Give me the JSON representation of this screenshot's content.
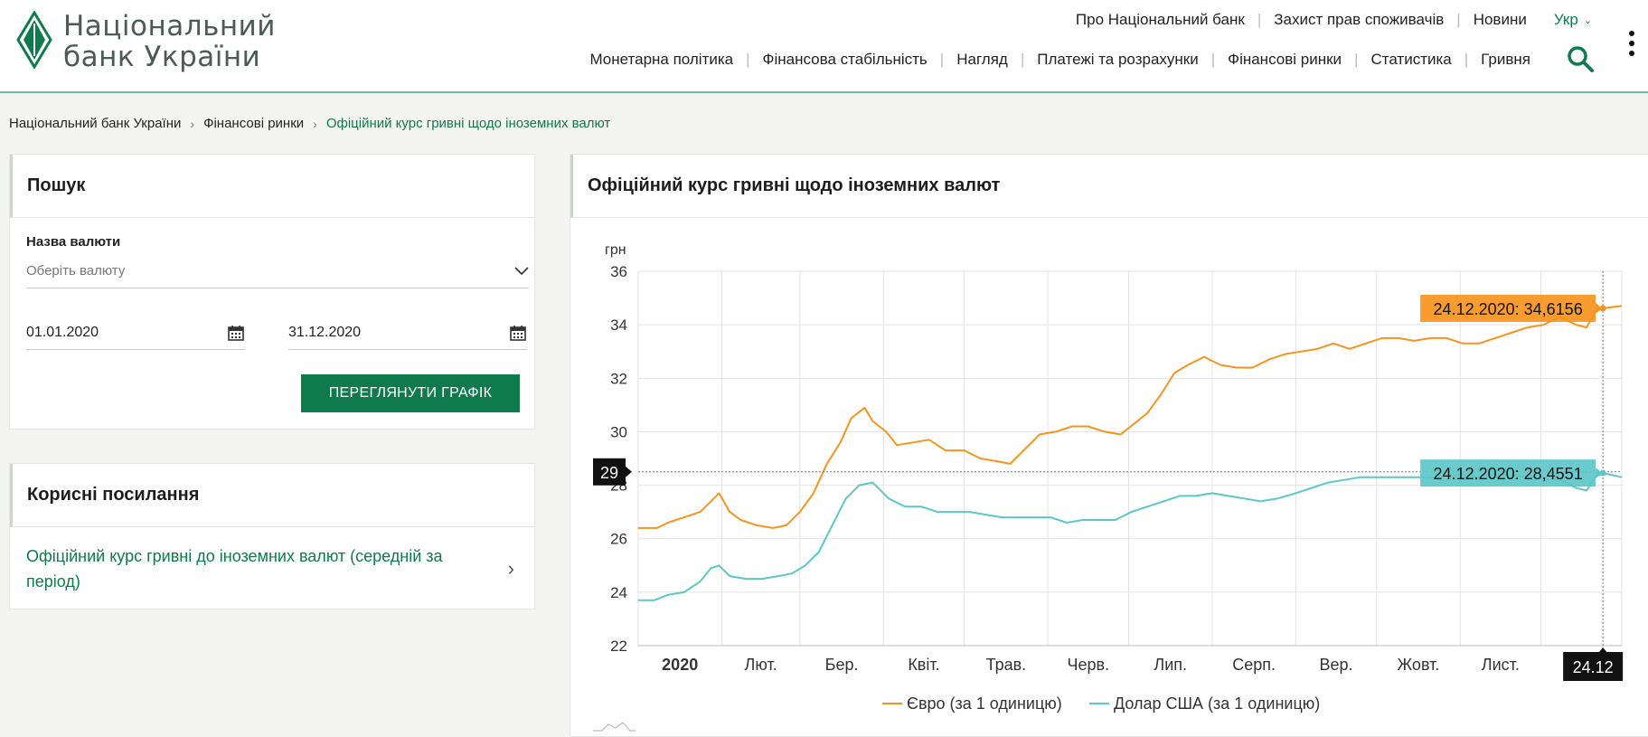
{
  "header": {
    "logo_line1": "Національний",
    "logo_line2": "банк України",
    "top_links": [
      "Про Національний банк",
      "Захист прав споживачів",
      "Новини"
    ],
    "language": "Укр",
    "main_nav": [
      "Монетарна політика",
      "Фінансова стабільність",
      "Нагляд",
      "Платежі та розрахунки",
      "Фінансові ринки",
      "Статистика",
      "Гривня"
    ],
    "brand_color": "#0f7b4c"
  },
  "breadcrumb": {
    "items": [
      "Національний банк України",
      "Фінансові ринки"
    ],
    "current": "Офіційний курс гривні щодо іноземних валют"
  },
  "search_panel": {
    "title": "Пошук",
    "currency_label": "Назва валюти",
    "currency_placeholder": "Оберіть валюту",
    "date_from": "01.01.2020",
    "date_to": "31.12.2020",
    "button": "ПЕРЕГЛЯНУТИ ГРАФІК"
  },
  "links_panel": {
    "title": "Корисні посилання",
    "link": "Офіційний курс гривні до іноземних валют (середній за період)"
  },
  "chart_panel": {
    "title": "Офіційний курс гривні щодо іноземних валют"
  },
  "chart_data": {
    "type": "line",
    "ylabel": "грн",
    "ylim": [
      22,
      36
    ],
    "yticks": [
      22,
      24,
      26,
      28,
      30,
      32,
      34,
      36
    ],
    "x_tick_labels": [
      "2020",
      "Лют.",
      "Бер.",
      "Квіт.",
      "Трав.",
      "Черв.",
      "Лип.",
      "Серп.",
      "Вер.",
      "Жовт.",
      "Лист."
    ],
    "x_tick_dates": [
      "2020-01-01",
      "2020-02-01",
      "2020-03-01",
      "2020-04-01",
      "2020-05-01",
      "2020-06-01",
      "2020-07-01",
      "2020-08-01",
      "2020-09-01",
      "2020-10-01",
      "2020-11-01",
      "2020-12-01"
    ],
    "x_range": [
      "2020-01-01",
      "2020-12-31"
    ],
    "grid": true,
    "legend_position": "bottom",
    "crosshair_date": "2020-12-24",
    "crosshair_x_label": "24.12",
    "crosshair_y_label": "29",
    "crosshair_y_value": 28.5,
    "series": [
      {
        "name": "Євро (за 1 одиницю)",
        "color": "#f7941d",
        "tooltip": "24.12.2020: 34,6156",
        "points": [
          [
            "2020-01-01",
            26.4
          ],
          [
            "2020-01-08",
            26.4
          ],
          [
            "2020-01-12",
            26.6
          ],
          [
            "2020-01-18",
            26.8
          ],
          [
            "2020-01-24",
            27.0
          ],
          [
            "2020-01-27",
            27.3
          ],
          [
            "2020-01-31",
            27.7
          ],
          [
            "2020-02-04",
            27.0
          ],
          [
            "2020-02-08",
            26.7
          ],
          [
            "2020-02-14",
            26.5
          ],
          [
            "2020-02-20",
            26.4
          ],
          [
            "2020-02-25",
            26.5
          ],
          [
            "2020-03-01",
            27.0
          ],
          [
            "2020-03-06",
            27.7
          ],
          [
            "2020-03-11",
            28.8
          ],
          [
            "2020-03-16",
            29.6
          ],
          [
            "2020-03-20",
            30.5
          ],
          [
            "2020-03-25",
            30.9
          ],
          [
            "2020-03-28",
            30.4
          ],
          [
            "2020-04-02",
            30.0
          ],
          [
            "2020-04-06",
            29.5
          ],
          [
            "2020-04-12",
            29.6
          ],
          [
            "2020-04-18",
            29.7
          ],
          [
            "2020-04-24",
            29.3
          ],
          [
            "2020-05-01",
            29.3
          ],
          [
            "2020-05-07",
            29.0
          ],
          [
            "2020-05-13",
            28.9
          ],
          [
            "2020-05-18",
            28.8
          ],
          [
            "2020-05-24",
            29.4
          ],
          [
            "2020-05-29",
            29.9
          ],
          [
            "2020-06-04",
            30.0
          ],
          [
            "2020-06-10",
            30.2
          ],
          [
            "2020-06-16",
            30.2
          ],
          [
            "2020-06-22",
            30.0
          ],
          [
            "2020-06-28",
            29.9
          ],
          [
            "2020-07-03",
            30.3
          ],
          [
            "2020-07-08",
            30.7
          ],
          [
            "2020-07-13",
            31.4
          ],
          [
            "2020-07-18",
            32.2
          ],
          [
            "2020-07-23",
            32.5
          ],
          [
            "2020-07-29",
            32.8
          ],
          [
            "2020-08-04",
            32.5
          ],
          [
            "2020-08-10",
            32.4
          ],
          [
            "2020-08-16",
            32.4
          ],
          [
            "2020-08-22",
            32.7
          ],
          [
            "2020-08-28",
            32.9
          ],
          [
            "2020-09-03",
            33.0
          ],
          [
            "2020-09-09",
            33.1
          ],
          [
            "2020-09-15",
            33.3
          ],
          [
            "2020-09-21",
            33.1
          ],
          [
            "2020-09-27",
            33.3
          ],
          [
            "2020-10-03",
            33.5
          ],
          [
            "2020-10-09",
            33.5
          ],
          [
            "2020-10-15",
            33.4
          ],
          [
            "2020-10-21",
            33.5
          ],
          [
            "2020-10-27",
            33.5
          ],
          [
            "2020-11-02",
            33.3
          ],
          [
            "2020-11-08",
            33.3
          ],
          [
            "2020-11-14",
            33.5
          ],
          [
            "2020-11-20",
            33.7
          ],
          [
            "2020-11-26",
            33.9
          ],
          [
            "2020-12-02",
            34.0
          ],
          [
            "2020-12-08",
            34.3
          ],
          [
            "2020-12-14",
            34.0
          ],
          [
            "2020-12-18",
            33.9
          ],
          [
            "2020-12-21",
            34.5
          ],
          [
            "2020-12-24",
            34.6156
          ],
          [
            "2020-12-31",
            34.7
          ]
        ]
      },
      {
        "name": "Долар США (за 1 одиницю)",
        "color": "#5cc7c7",
        "tooltip": "24.12.2020: 28,4551",
        "points": [
          [
            "2020-01-01",
            23.7
          ],
          [
            "2020-01-07",
            23.7
          ],
          [
            "2020-01-12",
            23.9
          ],
          [
            "2020-01-18",
            24.0
          ],
          [
            "2020-01-24",
            24.4
          ],
          [
            "2020-01-28",
            24.9
          ],
          [
            "2020-01-31",
            25.0
          ],
          [
            "2020-02-04",
            24.6
          ],
          [
            "2020-02-10",
            24.5
          ],
          [
            "2020-02-16",
            24.5
          ],
          [
            "2020-02-22",
            24.6
          ],
          [
            "2020-02-27",
            24.7
          ],
          [
            "2020-03-03",
            25.0
          ],
          [
            "2020-03-08",
            25.5
          ],
          [
            "2020-03-13",
            26.5
          ],
          [
            "2020-03-18",
            27.5
          ],
          [
            "2020-03-23",
            28.0
          ],
          [
            "2020-03-28",
            28.1
          ],
          [
            "2020-04-03",
            27.5
          ],
          [
            "2020-04-09",
            27.2
          ],
          [
            "2020-04-15",
            27.2
          ],
          [
            "2020-04-21",
            27.0
          ],
          [
            "2020-04-27",
            27.0
          ],
          [
            "2020-05-03",
            27.0
          ],
          [
            "2020-05-09",
            26.9
          ],
          [
            "2020-05-15",
            26.8
          ],
          [
            "2020-05-21",
            26.8
          ],
          [
            "2020-05-27",
            26.8
          ],
          [
            "2020-06-02",
            26.8
          ],
          [
            "2020-06-08",
            26.6
          ],
          [
            "2020-06-14",
            26.7
          ],
          [
            "2020-06-20",
            26.7
          ],
          [
            "2020-06-26",
            26.7
          ],
          [
            "2020-07-02",
            27.0
          ],
          [
            "2020-07-08",
            27.2
          ],
          [
            "2020-07-14",
            27.4
          ],
          [
            "2020-07-20",
            27.6
          ],
          [
            "2020-07-26",
            27.6
          ],
          [
            "2020-08-01",
            27.7
          ],
          [
            "2020-08-07",
            27.6
          ],
          [
            "2020-08-13",
            27.5
          ],
          [
            "2020-08-19",
            27.4
          ],
          [
            "2020-08-25",
            27.5
          ],
          [
            "2020-09-01",
            27.7
          ],
          [
            "2020-09-07",
            27.9
          ],
          [
            "2020-09-13",
            28.1
          ],
          [
            "2020-09-19",
            28.2
          ],
          [
            "2020-09-25",
            28.3
          ],
          [
            "2020-10-01",
            28.3
          ],
          [
            "2020-10-07",
            28.3
          ],
          [
            "2020-10-13",
            28.3
          ],
          [
            "2020-10-19",
            28.3
          ],
          [
            "2020-10-25",
            28.3
          ],
          [
            "2020-11-01",
            28.4
          ],
          [
            "2020-11-07",
            28.3
          ],
          [
            "2020-11-13",
            28.4
          ],
          [
            "2020-11-19",
            28.4
          ],
          [
            "2020-11-25",
            28.3
          ],
          [
            "2020-12-01",
            28.3
          ],
          [
            "2020-12-08",
            28.2
          ],
          [
            "2020-12-14",
            27.9
          ],
          [
            "2020-12-18",
            27.8
          ],
          [
            "2020-12-21",
            28.3
          ],
          [
            "2020-12-24",
            28.4551
          ],
          [
            "2020-12-31",
            28.3
          ]
        ]
      }
    ]
  }
}
